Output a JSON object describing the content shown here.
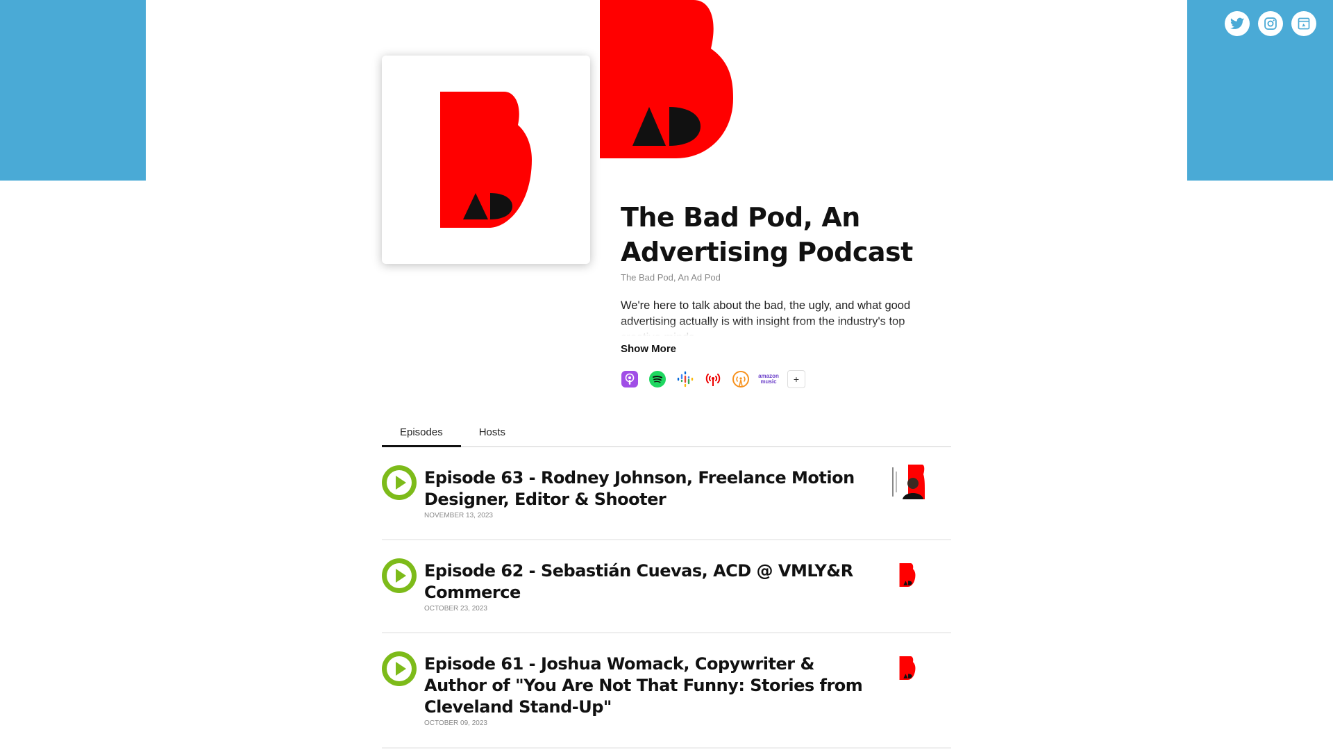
{
  "podcast": {
    "title": "The Bad Pod, An Advertising Podcast",
    "author": "The Bad Pod, An Ad Pod",
    "description": "We're here to talk about the bad, the ugly, and what good advertising actually is with insight from the industry's top creative minds.",
    "show_more": "Show More"
  },
  "social": {
    "icons": [
      "twitter-icon",
      "instagram-icon",
      "website-icon"
    ]
  },
  "platforms": {
    "items": [
      "apple-podcasts-icon",
      "spotify-icon",
      "google-podcasts-icon",
      "iheartradio-icon",
      "overcast-icon",
      "amazon-music-icon"
    ],
    "amazon_label_1": "amazon",
    "amazon_label_2": "music",
    "more": "+"
  },
  "tabs": [
    {
      "label": "Episodes",
      "active": true
    },
    {
      "label": "Hosts",
      "active": false
    }
  ],
  "episodes": [
    {
      "title": "Episode 63 - Rodney Johnson, Freelance Motion Designer, Editor & Shooter",
      "date": "NOVEMBER 13, 2023",
      "thumb": "guest-photo"
    },
    {
      "title": "Episode 62 - Sebastián Cuevas, ACD @ VMLY&R Commerce",
      "date": "OCTOBER 23, 2023",
      "thumb": "bad-pod-logo"
    },
    {
      "title": "Episode 61 - Joshua Womack, Copywriter & Author of \"You Are Not That Funny: Stories from Cleveland Stand-Up\"",
      "date": "OCTOBER 09, 2023",
      "thumb": "bad-pod-logo"
    }
  ],
  "colors": {
    "banner": "#4aaad6",
    "brand_red": "#ff0000",
    "play_green": "#7dbb1a"
  }
}
